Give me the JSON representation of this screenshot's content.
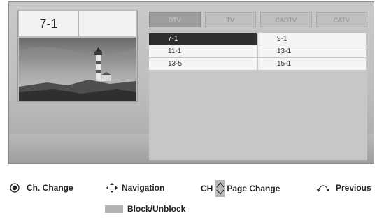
{
  "preview": {
    "channel": "7-1"
  },
  "tabs": [
    {
      "label": "DTV",
      "active": true
    },
    {
      "label": "TV",
      "active": false
    },
    {
      "label": "CADTV",
      "active": false
    },
    {
      "label": "CATV",
      "active": false
    }
  ],
  "channel_list": [
    [
      "7-1",
      "9-1"
    ],
    [
      "11-1",
      "13-1"
    ],
    [
      "13-5",
      "15-1"
    ]
  ],
  "selected_channel": "7-1",
  "legend": {
    "ch_change": "Ch. Change",
    "navigation": "Navigation",
    "ch_prefix": "CH",
    "page_change": "Page Change",
    "previous": "Previous",
    "block_unblock": "Block/Unblock"
  },
  "icons": {
    "ok": "ok-button-icon",
    "nav": "navigation-arrows-icon",
    "page": "channel-up-down-icon",
    "back": "back-arrow-icon"
  },
  "colors": {
    "selected_row": "#2e2e2e",
    "block_swatch": "#b2b2b2"
  }
}
